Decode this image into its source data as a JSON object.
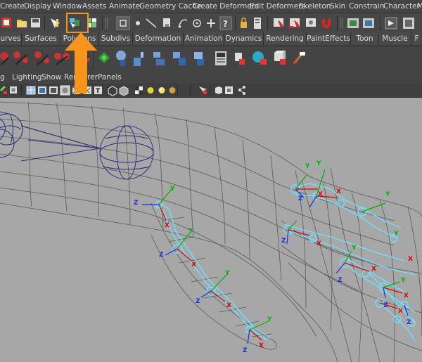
{
  "menu": {
    "items": [
      "Create",
      "Display",
      "Window",
      "Assets",
      "Animate",
      "Geometry Cache",
      "Create Deformers",
      "Edit Deformers",
      "Skeleton",
      "Skin",
      "Constrain",
      "Character",
      "M"
    ]
  },
  "shelf_tabs": [
    "urves",
    "Surfaces",
    "Polygons",
    "Subdivs",
    "Deformation",
    "Animation",
    "Dynamics",
    "Rendering",
    "PaintEffects",
    "Toon",
    "Muscle",
    "F"
  ],
  "panel_menu": [
    "g",
    "Lighting",
    "Show",
    "Renderer",
    "Panels"
  ],
  "colors": {
    "ui_bg": "#444444",
    "viewport_bg": "#a7a7a7",
    "highlight": "#f7941d",
    "wire": "#555555",
    "joint": "#2a2a78",
    "skeleton": "#6fe0ff",
    "axis_x": "#e00000",
    "axis_y": "#00b000",
    "axis_z": "#1a2fe0"
  },
  "icons": {
    "status_line": [
      "undo-icon",
      "open-scene-icon",
      "save-scene-icon",
      "select-by-hierarchy-icon",
      "select-by-object-type-icon",
      "select-by-component-icon",
      "select-mode-icon",
      "point-icon",
      "line-icon",
      "surface-icon",
      "curve-icon",
      "snap-point-icon",
      "snap-plane-icon",
      "question-icon",
      "lock-icon",
      "history-icon",
      "render-icon",
      "ipr-render-icon",
      "render-settings-icon",
      "magnet-icon",
      "construction-history-icon",
      "render-view-icon",
      "render-globals-icon",
      "show-hypershade-icon"
    ],
    "shelf": [
      "bone-icon",
      "ik-handle-icon",
      "ik-spline-icon",
      "insert-joint-icon",
      "mirror-joint-icon",
      "smooth-bind-icon",
      "rigid-bind-icon",
      "paint-weights-icon",
      "cluster-icon",
      "lattice-icon",
      "blend-shape-icon",
      "wire-deformer-icon",
      "sculpt-icon",
      "jiggle-icon",
      "wrap-icon",
      "soft-mod-icon",
      "paint-tool-icon"
    ],
    "panel_tools": [
      "wireframe-icon",
      "smooth-shade-icon",
      "smooth-wire-icon",
      "textured-icon",
      "x-ray-icon",
      "isolate-icon",
      "shadows-icon",
      "default-light-icon",
      "all-lights-icon",
      "use-lights-icon",
      "camera-icon",
      "grid-icon",
      "resolution-gate-icon"
    ]
  },
  "axes": {
    "x": "X",
    "y": "Y",
    "z": "Z"
  }
}
